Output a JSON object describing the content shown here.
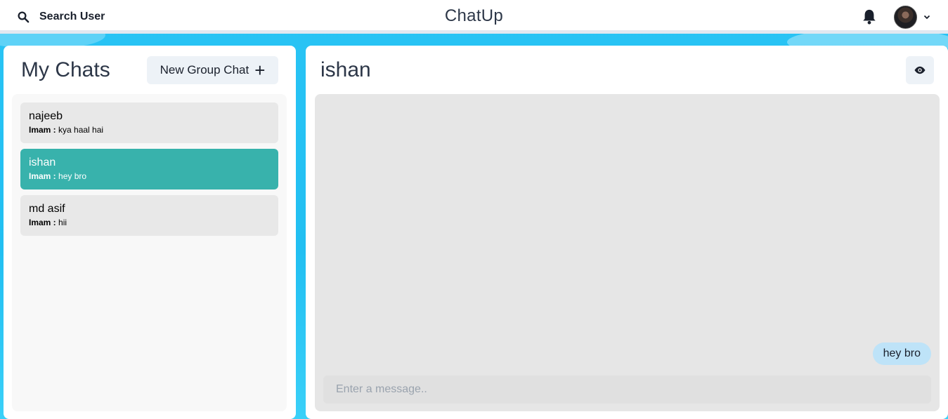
{
  "header": {
    "search_label": "Search User",
    "app_title": "ChatUp"
  },
  "sidebar": {
    "title": "My Chats",
    "new_group_label": "New Group Chat",
    "chats": [
      {
        "name": "najeeb",
        "sender": "Imam :",
        "latest": "kya haal hai",
        "selected": false
      },
      {
        "name": "ishan",
        "sender": "Imam :",
        "latest": "hey bro",
        "selected": true
      },
      {
        "name": "md asif",
        "sender": "Imam :",
        "latest": "hii",
        "selected": false
      }
    ]
  },
  "conversation": {
    "title": "ishan",
    "messages": [
      {
        "text": "hey bro",
        "own": true
      }
    ],
    "input_placeholder": "Enter a message.."
  },
  "colors": {
    "selected_chat": "#38b2ac",
    "own_message_bubble": "#bee3f8",
    "background": "#29c4f5"
  },
  "icons": [
    "search-icon",
    "bell-icon",
    "avatar",
    "chevron-down-icon",
    "plus-icon",
    "eye-icon"
  ]
}
